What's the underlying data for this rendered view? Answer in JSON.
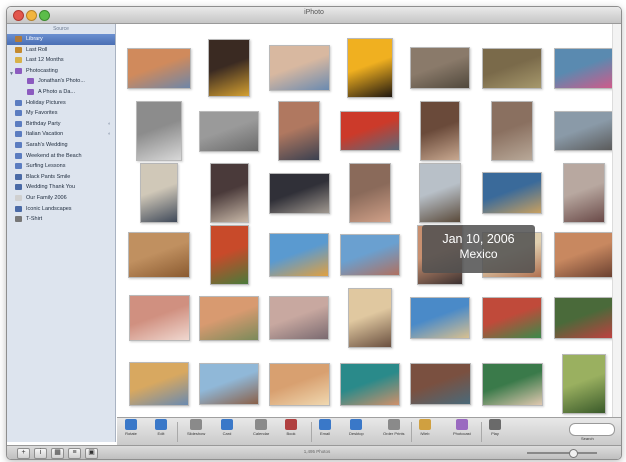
{
  "window": {
    "title": "iPhoto"
  },
  "sidebar": {
    "header": "Source",
    "items": [
      {
        "label": "Library",
        "selected": true,
        "icon": "library-icon",
        "color": "#b07a3a",
        "indent": 0
      },
      {
        "label": "Last Roll",
        "icon": "roll-icon",
        "color": "#c48a2e",
        "indent": 0
      },
      {
        "label": "Last 12 Months",
        "icon": "calendar-icon",
        "color": "#d8b24a",
        "indent": 0
      },
      {
        "label": "Photocasting",
        "icon": "photocast-icon",
        "color": "#8c5bbf",
        "indent": 0,
        "disclosure": "▼"
      },
      {
        "label": "Jonathan's Photo...",
        "icon": "photocast-icon",
        "color": "#8c5bbf",
        "indent": 1
      },
      {
        "label": "A Photo a Da...",
        "icon": "photocast-icon",
        "color": "#8c5bbf",
        "indent": 1
      },
      {
        "label": "Holiday Pictures",
        "icon": "album-icon",
        "color": "#5b7cc0",
        "indent": 0
      },
      {
        "label": "My Favorites",
        "icon": "album-icon",
        "color": "#5b7cc0",
        "indent": 0
      },
      {
        "label": "Birthday Party",
        "icon": "album-icon",
        "color": "#5b7cc0",
        "indent": 0,
        "trailing": "◐"
      },
      {
        "label": "Italian Vacation",
        "icon": "album-icon",
        "color": "#5b7cc0",
        "indent": 0,
        "trailing": "◐"
      },
      {
        "label": "Sarah's Wedding",
        "icon": "album-icon",
        "color": "#5b7cc0",
        "indent": 0
      },
      {
        "label": "Weekend at the Beach",
        "icon": "album-icon",
        "color": "#5b7cc0",
        "indent": 0
      },
      {
        "label": "Surfing Lessons",
        "icon": "album-icon",
        "color": "#5b7cc0",
        "indent": 0
      },
      {
        "label": "Black Pants Smile",
        "icon": "book-icon",
        "color": "#4a6aa6",
        "indent": 0
      },
      {
        "label": "Wedding Thank You",
        "icon": "card-icon",
        "color": "#4a6aa6",
        "indent": 0
      },
      {
        "label": "Our Family 2006",
        "icon": "calendar-icon",
        "color": "#d0d0d0",
        "indent": 0
      },
      {
        "label": "Iconic Landscapes",
        "icon": "book-icon",
        "color": "#4a6aa6",
        "indent": 0
      },
      {
        "label": "T-Shirt",
        "icon": "print-icon",
        "color": "#777777",
        "indent": 0
      }
    ]
  },
  "tooltip": {
    "date": "Jan 10, 2006",
    "location": "Mexico"
  },
  "photos": [
    {
      "name": "Florence",
      "c": [
        "#d08a5c",
        "#6e86a8"
      ]
    },
    {
      "name": "Smiling kids",
      "c": [
        "#3a2a22",
        "#d4a030"
      ]
    },
    {
      "name": "Boy portrait",
      "c": [
        "#d8b8a0",
        "#6a8ab0"
      ]
    },
    {
      "name": "Sunset",
      "c": [
        "#f0b020",
        "#201810"
      ]
    },
    {
      "name": "Coastline",
      "c": [
        "#8a7a6a",
        "#50483c"
      ]
    },
    {
      "name": "Medieval castle",
      "c": [
        "#7a6a4a",
        "#a6986c"
      ]
    },
    {
      "name": "Pink flowers",
      "c": [
        "#5a8ab0",
        "#d05a8a"
      ]
    },
    {
      "name": "Cathedral",
      "c": [
        "#8c8c8c",
        "#d8d8d8"
      ]
    },
    {
      "name": "Domes",
      "c": [
        "#9a9a9a",
        "#6a6a6a"
      ]
    },
    {
      "name": "Child",
      "c": [
        "#b07860",
        "#3a4050"
      ]
    },
    {
      "name": "Red car",
      "c": [
        "#cc3a2a",
        "#5a6a7a"
      ]
    },
    {
      "name": "Couple outdoors",
      "c": [
        "#6a4a3a",
        "#c8a890"
      ]
    },
    {
      "name": "Sightseeing",
      "c": [
        "#8a7060",
        "#b8a898"
      ]
    },
    {
      "name": "Pigeons",
      "c": [
        "#8a9aa8",
        "#5a5a5a"
      ]
    },
    {
      "name": "Beach child",
      "c": [
        "#d0c8b8",
        "#404a5a"
      ]
    },
    {
      "name": "Standing girl",
      "c": [
        "#4a3a3a",
        "#c8b8a8"
      ]
    },
    {
      "name": "Baby in hat",
      "c": [
        "#303038",
        "#a09890"
      ]
    },
    {
      "name": "Lighthouse",
      "c": [
        "#8a6a5a",
        "#d0a088"
      ]
    },
    {
      "name": "Hiker",
      "c": [
        "#b8c0c8",
        "#5a4a3a"
      ]
    },
    {
      "name": "Window shutters",
      "c": [
        "#3a6a9a",
        "#c8a060"
      ]
    },
    {
      "name": "Snow trip",
      "c": [
        "#b8a8a0",
        "#6a4a48"
      ]
    },
    {
      "name": "Palace",
      "c": [
        "#c09060",
        "#8a5a30"
      ]
    },
    {
      "name": "Girl in garden",
      "c": [
        "#c84a2a",
        "#4a7a3a"
      ]
    },
    {
      "name": "Running child",
      "c": [
        "#5a9ad0",
        "#e0a040"
      ]
    },
    {
      "name": "Boy at bay",
      "c": [
        "#6aa0d0",
        "#b07060"
      ]
    },
    {
      "name": "Group selfie",
      "c": [
        "#c89070",
        "#3a3030"
      ]
    },
    {
      "name": "Kid at beach",
      "c": [
        "#e0d0b0",
        "#b07050"
      ]
    },
    {
      "name": "Family",
      "c": [
        "#c88860",
        "#6a4030"
      ]
    },
    {
      "name": "Camera girl",
      "c": [
        "#d09080",
        "#f0d8d0"
      ]
    },
    {
      "name": "Three girls",
      "c": [
        "#d89a70",
        "#7a8a5a"
      ]
    },
    {
      "name": "Smiling woman",
      "c": [
        "#c8a8a0",
        "#7a6a70"
      ]
    },
    {
      "name": "Straw hat",
      "c": [
        "#e0c8a0",
        "#6a5040"
      ]
    },
    {
      "name": "Coaster",
      "c": [
        "#4a8ac8",
        "#d8c090"
      ]
    },
    {
      "name": "Colorful sign",
      "c": [
        "#c04a3a",
        "#3a8a4a"
      ]
    },
    {
      "name": "Shell art",
      "c": [
        "#4a6a3a",
        "#c04040"
      ]
    },
    {
      "name": "Beach walk",
      "c": [
        "#d8a860",
        "#6a8ab0"
      ]
    },
    {
      "name": "Shore kids",
      "c": [
        "#90b8d8",
        "#8a6048"
      ]
    },
    {
      "name": "Sunbathing",
      "c": [
        "#d8a070",
        "#f0d8b0"
      ]
    },
    {
      "name": "Teal hat",
      "c": [
        "#2a8a8a",
        "#d0906a"
      ]
    },
    {
      "name": "Two friends",
      "c": [
        "#7a5040",
        "#4a6a7a"
      ]
    },
    {
      "name": "Hammock",
      "c": [
        "#3a7a4a",
        "#e0c8b0"
      ]
    },
    {
      "name": "Field",
      "c": [
        "#9ab060",
        "#3a5a2a"
      ]
    }
  ],
  "toolbar": {
    "buttons": [
      {
        "label": "Rotate",
        "icon": "rotate-icon",
        "color": "#3a78c8"
      },
      {
        "label": "Edit",
        "icon": "edit-icon",
        "color": "#3a78c8"
      },
      {
        "label": "Slideshow",
        "icon": "slideshow-icon",
        "color": "#8a8a8a"
      },
      {
        "label": "Card",
        "icon": "card-icon",
        "color": "#3a78c8"
      },
      {
        "label": "Calendar",
        "icon": "calendar-icon",
        "color": "#8a8a8a"
      },
      {
        "label": "Book",
        "icon": "book-icon",
        "color": "#b04040"
      },
      {
        "label": "Email",
        "icon": "email-icon",
        "color": "#3a78c8"
      },
      {
        "label": "Desktop",
        "icon": "desktop-icon",
        "color": "#3a78c8"
      },
      {
        "label": "Order Prints",
        "icon": "prints-icon",
        "color": "#8a8a8a"
      },
      {
        "label": "iWeb",
        "icon": "iweb-icon",
        "color": "#d0a040"
      },
      {
        "label": "Photocast",
        "icon": "photocast-icon",
        "color": "#9a6ac0"
      },
      {
        "label": "Play",
        "icon": "play-icon",
        "color": "#6a6a6a"
      }
    ],
    "search_label": "Search"
  },
  "statusbar": {
    "count": "1,495 Photos"
  }
}
